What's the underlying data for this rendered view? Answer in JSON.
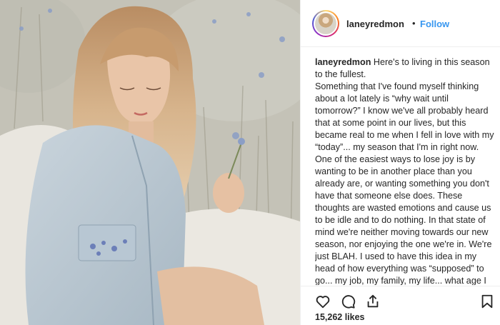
{
  "post": {
    "username": "laneyredmon",
    "dot": "•",
    "follow_label": "Follow"
  },
  "caption": {
    "username": "laneyredmon",
    "first_line": "Here's to living in this season to the fullest.",
    "body": "Something that I've found myself thinking about a lot lately is “why wait until tomorrow?” I know we've all probably heard that at some point in our lives, but this became real to me when I fell in love with my “today”... my season that I'm in right now. One of the easiest ways to lose joy is by wanting to be in another place than you already are, or wanting something you don't have that someone else does. These thoughts are wasted emotions and cause us to be idle and to do nothing. In that state of mind we're neither moving towards our new season, nor enjoying the one we're in. We're just BLAH. I used to have this idea in my head of how everything was “supposed” to go... my job, my family, my life... what age I would be when certain things happened... But the"
  },
  "stats": {
    "likes": "15,262 likes"
  },
  "icons": {
    "like": "heart-icon",
    "comment": "comment-icon",
    "share": "share-icon",
    "save": "bookmark-icon"
  },
  "colors": {
    "follow": "#3897f0",
    "text": "#262626",
    "border": "#efefef"
  }
}
